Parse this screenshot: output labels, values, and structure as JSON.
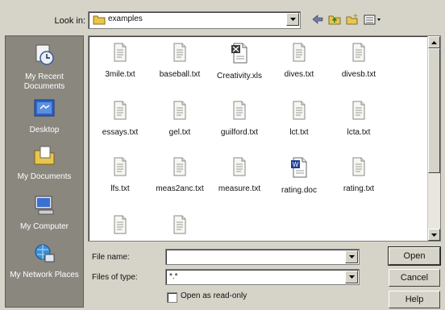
{
  "look_in": {
    "label": "Look in:",
    "value": "examples"
  },
  "places": [
    {
      "label": "My Recent Documents",
      "icon": "recent-documents-icon"
    },
    {
      "label": "Desktop",
      "icon": "desktop-icon"
    },
    {
      "label": "My Documents",
      "icon": "my-documents-icon"
    },
    {
      "label": "My Computer",
      "icon": "my-computer-icon"
    },
    {
      "label": "My Network Places",
      "icon": "network-places-icon"
    }
  ],
  "files": [
    {
      "name": "3mile.txt",
      "type": "txt"
    },
    {
      "name": "baseball.txt",
      "type": "txt"
    },
    {
      "name": "Creativity.xls",
      "type": "xls"
    },
    {
      "name": "dives.txt",
      "type": "txt"
    },
    {
      "name": "divesb.txt",
      "type": "txt"
    },
    {
      "name": "essays.txt",
      "type": "txt"
    },
    {
      "name": "gel.txt",
      "type": "txt"
    },
    {
      "name": "guilford.txt",
      "type": "txt"
    },
    {
      "name": "lct.txt",
      "type": "txt"
    },
    {
      "name": "lcta.txt",
      "type": "txt"
    },
    {
      "name": "lfs.txt",
      "type": "txt"
    },
    {
      "name": "meas2anc.txt",
      "type": "txt"
    },
    {
      "name": "measure.txt",
      "type": "txt"
    },
    {
      "name": "rating.doc",
      "type": "doc"
    },
    {
      "name": "rating.txt",
      "type": "txt"
    },
    {
      "name": "",
      "type": "txt"
    },
    {
      "name": "",
      "type": "txt"
    }
  ],
  "file_name": {
    "label": "File name:",
    "value": ""
  },
  "files_of_type": {
    "label": "Files of type:",
    "value": "*.*"
  },
  "read_only": {
    "label": "Open as read-only",
    "checked": false
  },
  "buttons": {
    "open": "Open",
    "cancel": "Cancel",
    "help": "Help"
  },
  "colors": {
    "dialog": "#d6d3c9",
    "places_bar": "#8a877f",
    "folder": "#e8c64c"
  }
}
